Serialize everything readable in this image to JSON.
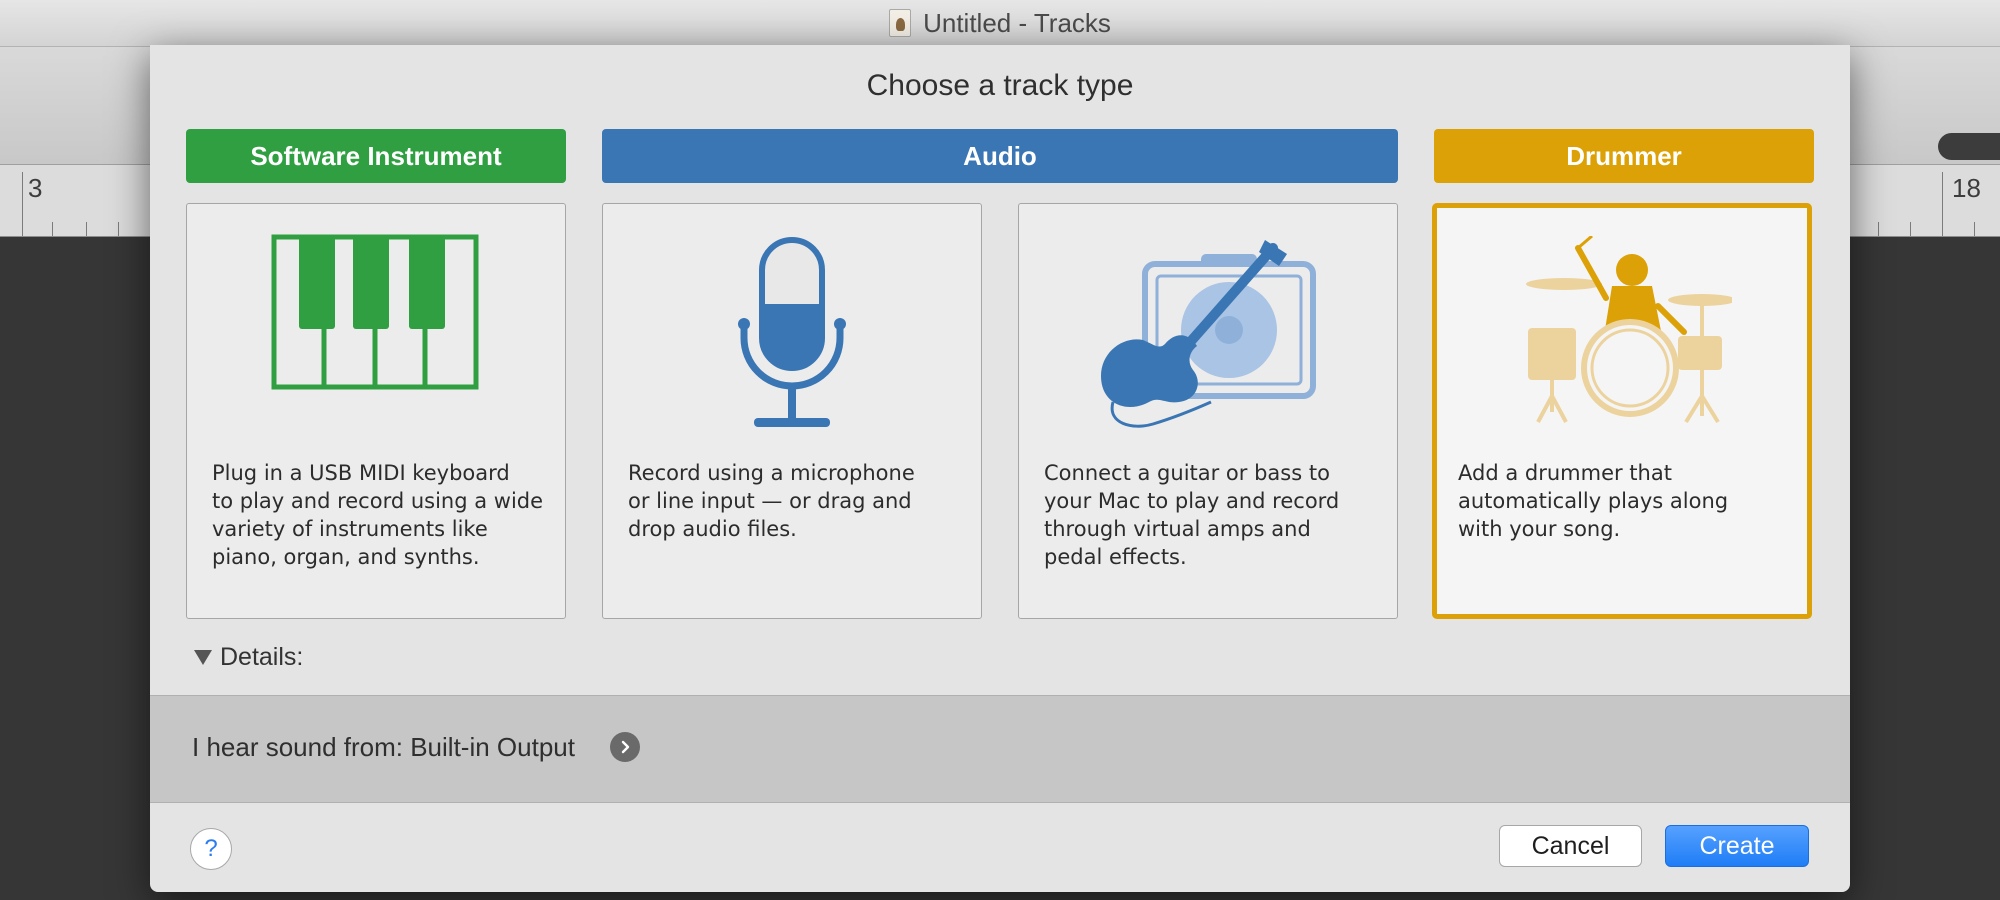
{
  "window": {
    "title": "Untitled - Tracks"
  },
  "ruler": {
    "left_number": "3",
    "right_number": "18"
  },
  "dialog": {
    "title": "Choose a track type",
    "categories": [
      "Software Instrument",
      "Audio",
      "Drummer"
    ],
    "cards": [
      {
        "icon": "piano-keys-icon",
        "description": "Plug in a USB MIDI keyboard\nto play and record using a wide\nvariety of instruments like\npiano, organ, and synths."
      },
      {
        "icon": "microphone-icon",
        "description": "Record using a microphone\nor line input — or drag and\ndrop audio files."
      },
      {
        "icon": "guitar-amp-icon",
        "description": "Connect a guitar or bass to\nyour Mac to play and record\nthrough virtual amps and\npedal effects."
      },
      {
        "icon": "drummer-icon",
        "description": "Add a drummer that\nautomatically plays along\nwith your song.",
        "selected": true
      }
    ],
    "details_label": "Details:",
    "output_label": "I hear sound from: Built-in Output",
    "help_label": "?",
    "cancel_label": "Cancel",
    "create_label": "Create"
  },
  "colors": {
    "software_instrument": "#2f9f41",
    "audio": "#3a76b4",
    "drummer": "#dca106",
    "create_button": "#1f7df6"
  }
}
